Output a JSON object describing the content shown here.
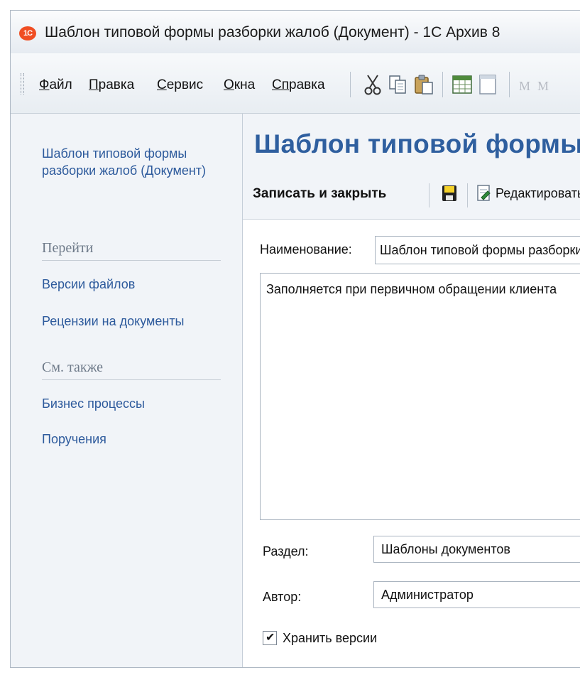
{
  "window": {
    "logo_text": "1C",
    "title": "Шаблон типовой формы разборки жалоб (Документ) - 1С Архив 8"
  },
  "menu": {
    "items": [
      {
        "underline": "Ф",
        "rest": "айл"
      },
      {
        "underline": "П",
        "rest": "равка"
      },
      {
        "underline": "С",
        "rest": "ервис"
      },
      {
        "underline": "О",
        "rest": "кна"
      },
      {
        "underline": "Сп",
        "rest": "равка"
      }
    ]
  },
  "toolbar": {
    "icons": [
      "cut-icon",
      "copy-icon",
      "paste-icon",
      "spreadsheet-icon",
      "text-document-icon"
    ],
    "letters": [
      "M",
      "M"
    ]
  },
  "sidebar": {
    "title": "Шаблон типовой формы разборки жалоб (Документ)",
    "goto_header": "Перейти",
    "goto_items": [
      "Версии файлов",
      "Рецензии на документы"
    ],
    "see_also_header": "См. также",
    "see_also_items": [
      "Бизнес процессы",
      "Поручения"
    ]
  },
  "form": {
    "title": "Шаблон типовой формы разборки жалоб",
    "commands": {
      "save_close": "Записать и закрыть",
      "edit": "Редактировать"
    },
    "name_label": "Наименование:",
    "name_value": "Шаблон типовой формы разборки жалоб",
    "description": "Заполняется при первичном обращении клиента",
    "section_label": "Раздел:",
    "section_value": "Шаблоны документов",
    "author_label": "Автор:",
    "author_value": "Администратор",
    "keep_versions_label": "Хранить версии",
    "keep_versions_checked": true
  },
  "colors": {
    "accent": "#2f5f9f",
    "link": "#2d5a9c",
    "logo": "#f04e23"
  }
}
